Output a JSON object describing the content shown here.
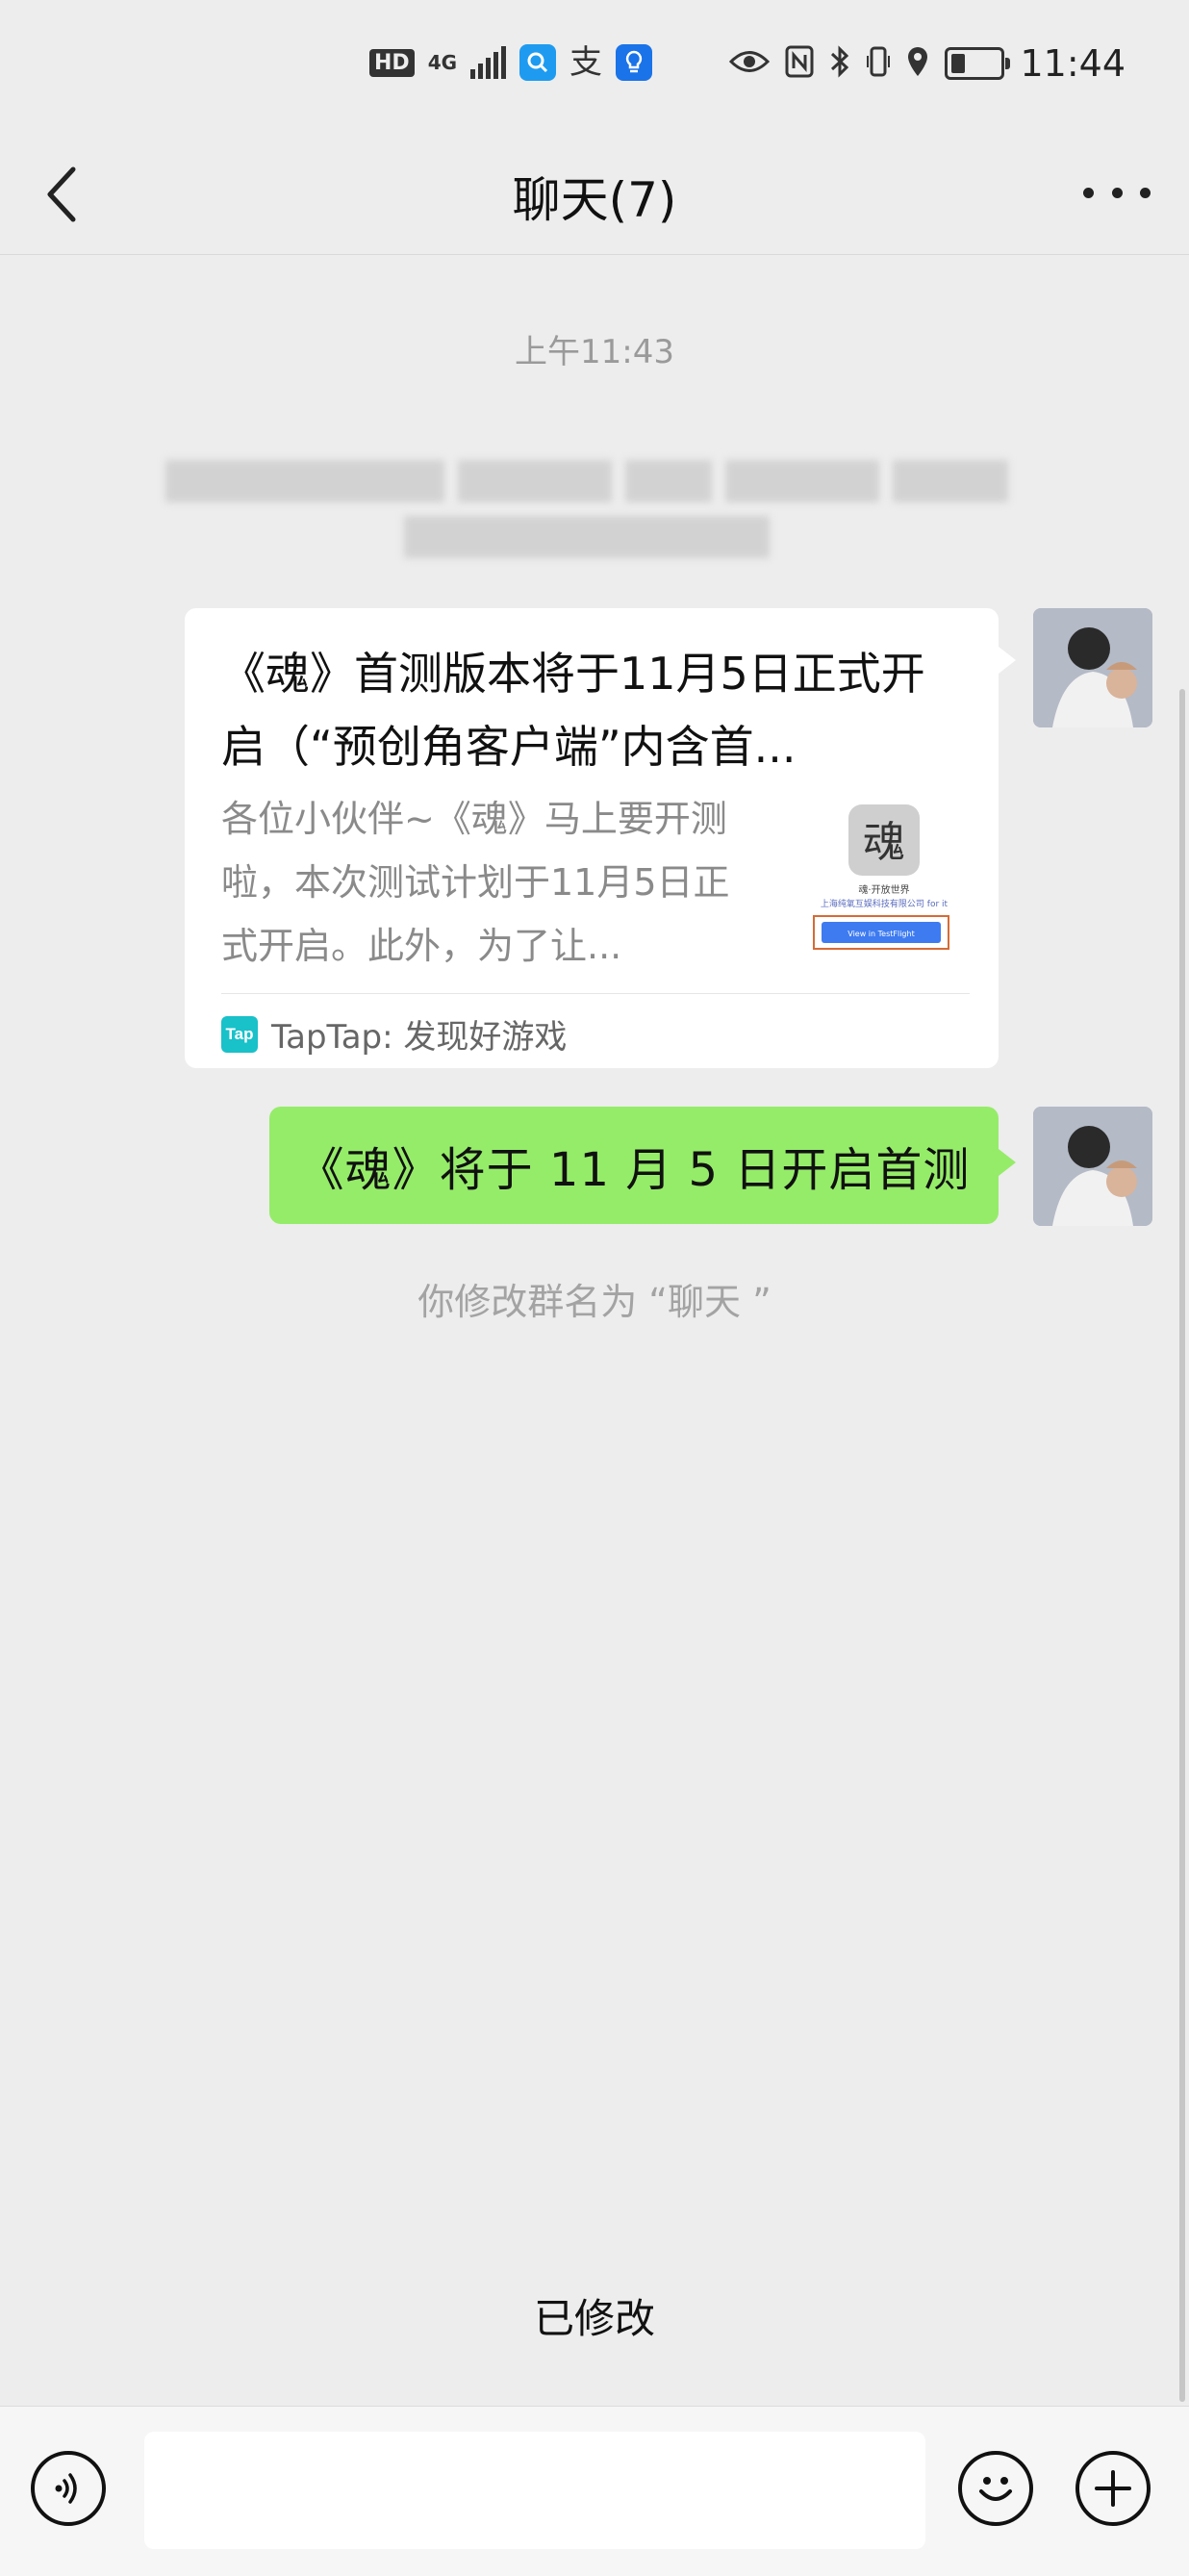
{
  "status_bar": {
    "hd": "HD",
    "network": "4G",
    "time": "11:44"
  },
  "header": {
    "title": "聊天(7)"
  },
  "chat": {
    "timestamp": "上午11:43",
    "card": {
      "title": "《魂》首测版本将于11月5日正式开启（“预创角客户端”内含首...",
      "description": "各位小伙伴~《魂》马上要开测啦，本次测试计划于11月5日正式开启。此外，为了让...",
      "source": "TapTap: 发现好游戏",
      "source_logo": "Tap",
      "thumb_caption": "魂·开放世界",
      "thumb_company": "上海纯氧互娱科技有限公司 for it",
      "thumb_button": "View in TestFlight",
      "thumb_logo_char": "魂"
    },
    "text_message": "《魂》将于 11 月 5 日开启首测",
    "system_message": "你修改群名为 “聊天 ”"
  },
  "toast": "已修改",
  "input_bar": {
    "value": ""
  },
  "colors": {
    "background": "#ededed",
    "bubble_green": "#95ec69",
    "card_white": "#ffffff",
    "taptap_brand": "#19c1c9"
  },
  "icons": {
    "back": "chevron-left-icon",
    "more": "more-horizontal-icon",
    "voice": "voice-icon",
    "emoji": "smiley-icon",
    "plus": "plus-circle-icon"
  }
}
